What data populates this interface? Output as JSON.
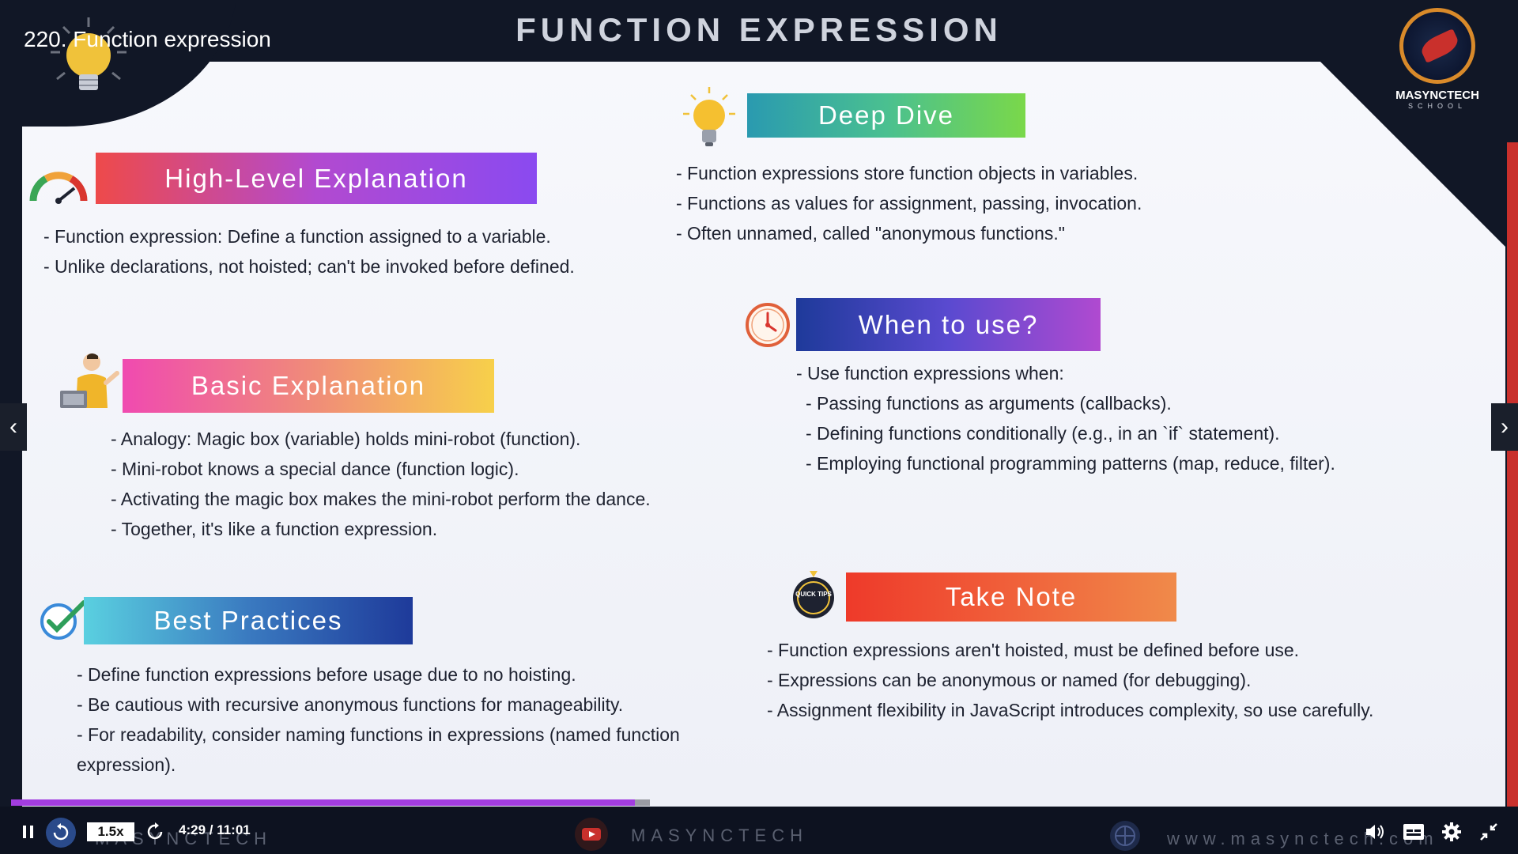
{
  "video": {
    "title": "220. Function expression",
    "slide_title": "FUNCTION EXPRESSION"
  },
  "brand": {
    "name": "MASYNCTECH",
    "sub": "SCHOOL"
  },
  "sections": {
    "high_level": {
      "title": "High-Level Explanation",
      "bullets": [
        "- Function expression: Define a function assigned to a variable.",
        "- Unlike declarations, not hoisted; can't be invoked before defined."
      ]
    },
    "basic": {
      "title": "Basic Explanation",
      "bullets": [
        "- Analogy: Magic box (variable) holds mini-robot (function).",
        "- Mini-robot knows a special dance (function logic).",
        "- Activating the magic box makes the mini-robot perform the dance.",
        "- Together, it's like a function expression."
      ]
    },
    "best_practices": {
      "title": "Best Practices",
      "bullets": [
        "- Define function expressions before usage due to no hoisting.",
        "- Be cautious with recursive anonymous functions for manageability.",
        "- For readability, consider naming functions in expressions (named function expression)."
      ]
    },
    "deep_dive": {
      "title": "Deep Dive",
      "bullets": [
        "- Function expressions store function objects in variables.",
        "- Functions as values for assignment, passing, invocation.",
        "- Often unnamed, called \"anonymous functions.\""
      ]
    },
    "when_to_use": {
      "title": "When to use?",
      "bullets": [
        "- Use function expressions when:",
        "- Passing functions as arguments (callbacks).",
        "- Defining functions conditionally (e.g., in an `if` statement).",
        "- Employing functional programming patterns (map, reduce, filter)."
      ]
    },
    "take_note": {
      "title": "Take Note",
      "bullets": [
        "- Function expressions aren't hoisted, must be defined before use.",
        "- Expressions can be anonymous or named (for debugging).",
        "- Assignment flexibility in JavaScript introduces complexity, so use carefully."
      ]
    }
  },
  "quick_tips_label": "QUICK TIPS",
  "player": {
    "speed": "1.5x",
    "time": "4:29 / 11:01",
    "progress": 0.42,
    "buffered": 0.43,
    "watermark_left": "MASYNCTECH",
    "watermark_center": "MASYNCTECH",
    "watermark_right": "www.masynctech.com",
    "prev_arrow": "‹",
    "next_arrow": "›"
  },
  "colors": {
    "progress": "#a23de0",
    "accent_red": "#c9302c"
  }
}
